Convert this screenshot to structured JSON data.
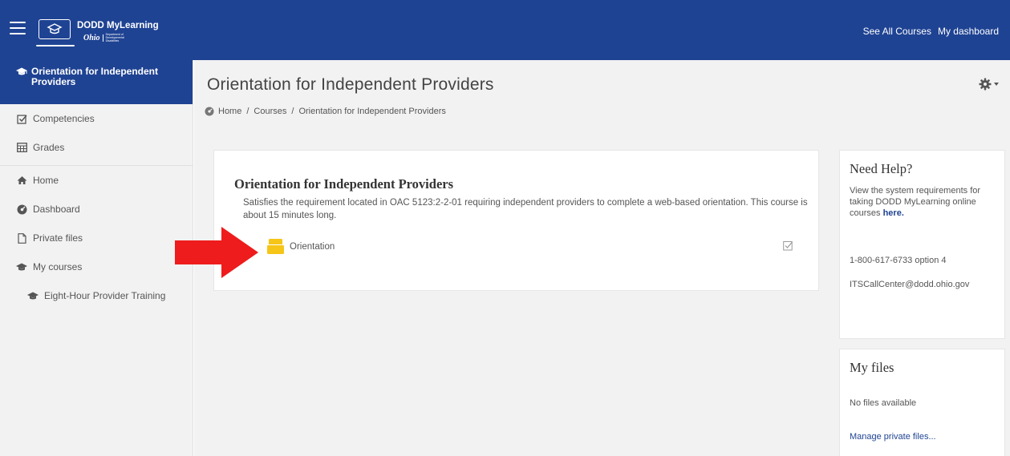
{
  "navbar": {
    "logo_title": "DODD MyLearning",
    "logo_ohio": "Ohio",
    "logo_dept": "Department of Developmental Disabilities",
    "links": [
      "See All Courses",
      "My dashboard"
    ]
  },
  "sidebar": {
    "active": "Orientation for Independent Providers",
    "items": [
      {
        "label": "Competencies",
        "icon": "checkbox-icon"
      },
      {
        "label": "Grades",
        "icon": "table-icon"
      },
      {
        "label": "Home",
        "icon": "home-icon"
      },
      {
        "label": "Dashboard",
        "icon": "dashboard-icon"
      },
      {
        "label": "Private files",
        "icon": "file-icon"
      },
      {
        "label": "My courses",
        "icon": "graduation-cap-icon"
      },
      {
        "label": "Eight-Hour Provider Training",
        "icon": "graduation-cap-icon"
      }
    ]
  },
  "main": {
    "page_title": "Orientation for Independent Providers",
    "breadcrumb": [
      "Home",
      "Courses",
      "Orientation for Independent Providers"
    ],
    "course": {
      "title": "Orientation for Independent Providers",
      "description": "Satisfies the requirement located in OAC 5123:2-2-01 requiring independent providers to complete a web-based orientation. This course is about 15 minutes long.",
      "activity_label": "Orientation"
    }
  },
  "blocks": {
    "help": {
      "title": "Need Help?",
      "text": "View the system requirements for taking DODD MyLearning online courses ",
      "link": "here.",
      "phone": "1-800-617-6733 option 4",
      "email": "ITSCallCenter@dodd.ohio.gov"
    },
    "files": {
      "title": "My files",
      "empty": "No files available",
      "manage_link": "Manage private files..."
    }
  },
  "colors": {
    "brand": "#1f4393",
    "arrow": "#ee1c1c",
    "activity_icon": "#f5c518"
  }
}
